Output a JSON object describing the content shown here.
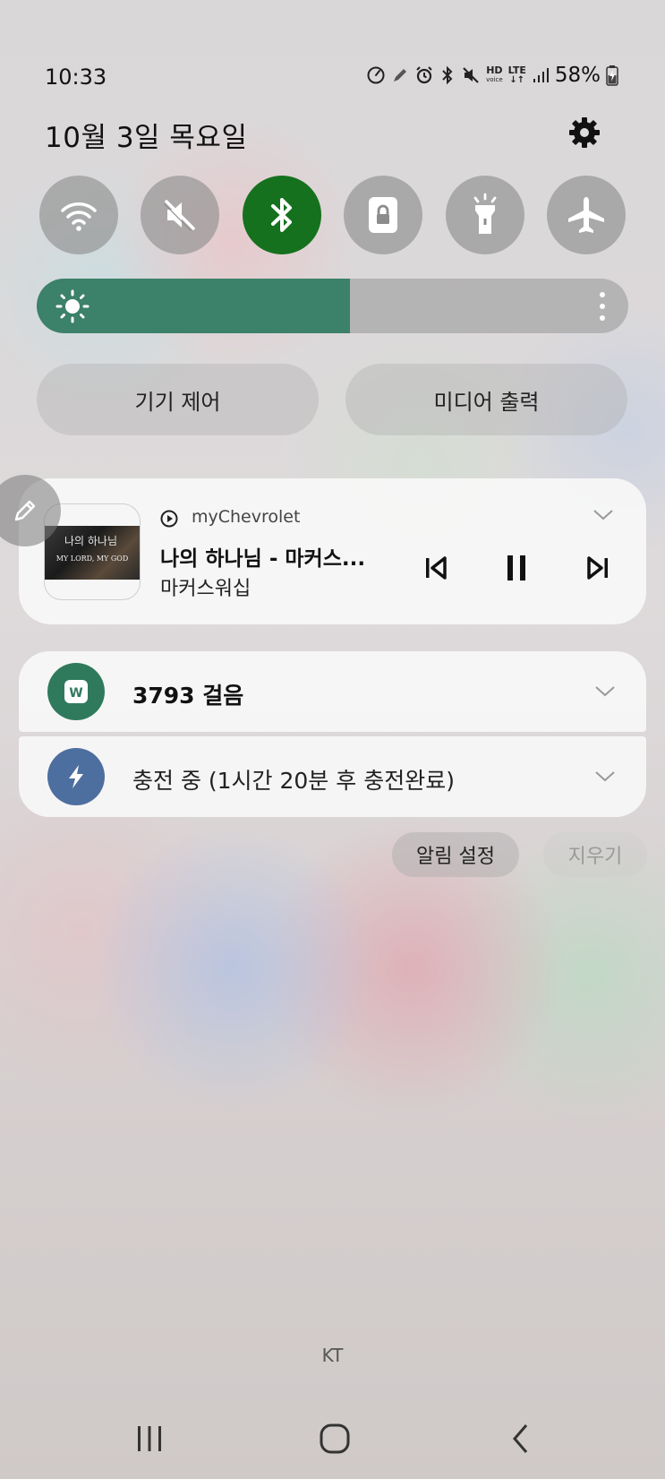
{
  "status_bar": {
    "time": "10:33",
    "hd_line1": "HD",
    "hd_line2": "voice",
    "lte": "LTE",
    "battery": "58%",
    "icons": [
      "speedometer-icon",
      "pen-icon",
      "alarm-icon",
      "bluetooth-icon",
      "mute-icon",
      "hd-voice-icon",
      "lte-icon",
      "signal-icon",
      "battery-charging-icon"
    ]
  },
  "header": {
    "date": "10월 3일 목요일",
    "settings_icon": "gear-icon"
  },
  "quick_settings": [
    {
      "name": "wifi",
      "icon": "wifi-icon",
      "active": false
    },
    {
      "name": "mute",
      "icon": "mute-icon",
      "active": false
    },
    {
      "name": "bluetooth",
      "icon": "bluetooth-icon",
      "active": true
    },
    {
      "name": "screen-lock",
      "icon": "lock-icon",
      "active": false
    },
    {
      "name": "flashlight",
      "icon": "flashlight-icon",
      "active": false
    },
    {
      "name": "airplane",
      "icon": "airplane-icon",
      "active": false
    }
  ],
  "brightness": {
    "level_percent": 53,
    "fill_color": "#3c8169"
  },
  "buttons": {
    "device_control": "기기 제어",
    "media_output": "미디어 출력"
  },
  "media": {
    "app_name": "myChevrolet",
    "title": "나의 하나님 - 마커스...",
    "artist": "마커스워십",
    "album_art_title": "나의 하나님",
    "album_art_subtitle": "MY LORD, MY GOD",
    "controls": [
      "previous-icon",
      "pause-icon",
      "next-icon"
    ]
  },
  "notifications": [
    {
      "text": "3793 걸음",
      "icon": "w-app-icon",
      "color": "#2f7a5d"
    },
    {
      "text": "충전 중 (1시간 20분 후 충전완료)",
      "icon": "lightning-icon",
      "color": "#4d6f9f"
    }
  ],
  "actions": {
    "notification_settings": "알림 설정",
    "clear": "지우기"
  },
  "carrier": "KT",
  "navigation": [
    "recent-apps-icon",
    "home-icon",
    "back-icon"
  ],
  "colors": {
    "bluetooth_active": "#15711d"
  }
}
